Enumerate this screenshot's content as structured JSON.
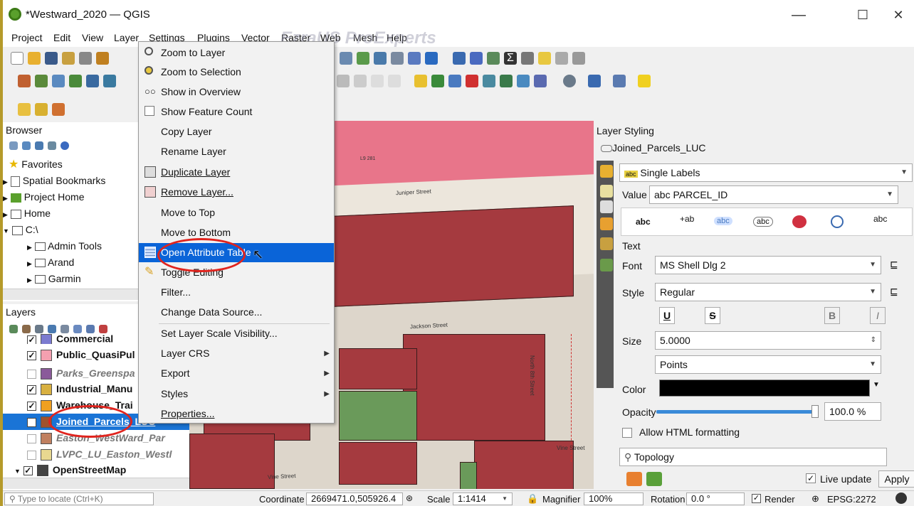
{
  "window": {
    "title": "*Westward_2020 — QGIS",
    "minimize": "—",
    "maximize": "☐",
    "close": "✕"
  },
  "menubar": [
    "Project",
    "Edit",
    "View",
    "Layer",
    "Settings",
    "Plugins",
    "Vector",
    "Raster",
    "Web",
    "Mesh",
    "Help"
  ],
  "watermark": "EzraUS ProExperts",
  "browser": {
    "title": "Browser",
    "items": [
      "Favorites",
      "Spatial Bookmarks",
      "Project Home",
      "Home",
      "C:\\",
      "Admin Tools",
      "Arand",
      "Garmin"
    ]
  },
  "layers": {
    "title": "Layers",
    "items": [
      {
        "name": "Commercial",
        "checked": true,
        "color": "#7b7bd0",
        "style": "bold"
      },
      {
        "name": "Public_QuasiPul",
        "checked": true,
        "color": "#f4a0b0",
        "style": "bold"
      },
      {
        "name": "Parks_Greenspa",
        "checked": false,
        "color": "#8a5a9a",
        "style": "italic"
      },
      {
        "name": "Industrial_Manu",
        "checked": true,
        "color": "#d8b040",
        "style": "bold"
      },
      {
        "name": "Warehouse_Trai",
        "checked": true,
        "color": "#f0a020",
        "style": "bold"
      },
      {
        "name": "Joined_Parcels_LUC",
        "checked": true,
        "color": "#a0522d",
        "style": "selected"
      },
      {
        "name": "Easton_WestWard_Par",
        "checked": false,
        "color": "#c08060",
        "style": "italic"
      },
      {
        "name": "LVPC_LU_Easton_Westl",
        "checked": false,
        "color": "#e8d890",
        "style": "italic"
      },
      {
        "name": "OpenStreetMap",
        "checked": true,
        "color": "#444",
        "style": "bold"
      }
    ]
  },
  "context_menu": [
    {
      "label": "Zoom to Layer",
      "icon": "zoom-icon",
      "arrow": false
    },
    {
      "label": "Zoom to Selection",
      "icon": "zoom-icon",
      "arrow": false
    },
    {
      "label": "Show in Overview",
      "icon": "overview-icon",
      "arrow": false
    },
    {
      "label": "Show Feature Count",
      "icon": "checkbox-icon",
      "arrow": false
    },
    {
      "label": "Copy Layer",
      "icon": "",
      "arrow": false
    },
    {
      "label": "Rename Layer",
      "icon": "",
      "arrow": false
    },
    {
      "label": "Duplicate Layer",
      "icon": "duplicate-icon",
      "arrow": false
    },
    {
      "label": "Remove Layer...",
      "icon": "remove-icon",
      "arrow": false
    },
    {
      "label": "Move to Top",
      "icon": "",
      "arrow": false
    },
    {
      "label": "Move to Bottom",
      "icon": "",
      "arrow": false
    },
    {
      "label": "Open Attribute Table",
      "icon": "table-icon",
      "arrow": false,
      "highlighted": true
    },
    {
      "label": "Toggle Editing",
      "icon": "pencil-icon",
      "arrow": false
    },
    {
      "label": "Filter...",
      "icon": "",
      "arrow": false
    },
    {
      "label": "Change Data Source...",
      "icon": "",
      "arrow": false
    },
    {
      "label": "Set Layer Scale Visibility...",
      "icon": "",
      "arrow": false
    },
    {
      "label": "Layer CRS",
      "icon": "",
      "arrow": true
    },
    {
      "label": "Export",
      "icon": "",
      "arrow": true
    },
    {
      "label": "Styles",
      "icon": "",
      "arrow": true
    },
    {
      "label": "Properties...",
      "icon": "",
      "arrow": false
    }
  ],
  "map": {
    "streets": [
      "Juniper Street",
      "Jackson Street",
      "North 8th Street",
      "Vine Street",
      "Vine Street"
    ],
    "top_label": "L9 281"
  },
  "styling": {
    "title": "Layer Styling",
    "layer": "Joined_Parcels_LUC",
    "mode": "Single Labels",
    "value_label": "Value",
    "value": "abc PARCEL_ID",
    "section": "Text",
    "font_label": "Font",
    "font": "MS Shell Dlg 2",
    "style_label": "Style",
    "style": "Regular",
    "size_label": "Size",
    "size": "5.0000",
    "units": "Points",
    "color_label": "Color",
    "opacity_label": "Opacity",
    "opacity": "100.0 %",
    "opacity_value": 1.0,
    "html_label": "Allow HTML formatting",
    "search": "Topology",
    "live_update": "Live update",
    "apply": "Apply"
  },
  "status": {
    "locate": "Type to locate (Ctrl+K)",
    "coord_label": "Coordinate",
    "coord": "2669471.0,505926.4",
    "scale_label": "Scale",
    "scale": "1:1414",
    "magnifier_label": "Magnifier",
    "magnifier": "100%",
    "rotation_label": "Rotation",
    "rotation": "0.0 °",
    "render": "Render",
    "crs": "EPSG:2272"
  }
}
